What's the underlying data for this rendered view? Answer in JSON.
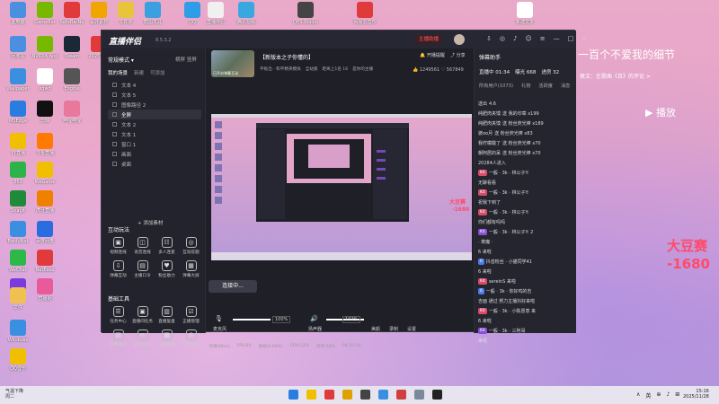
{
  "desktop": {
    "icons": [
      "此电脑",
      "GameBar",
      "ServBarNe",
      "设计素材",
      "文件夹",
      "截图工具",
      "QQ",
      "直播伴侣",
      "腾讯视频",
      "OBS Studio",
      "网易云音乐",
      "新建文本",
      "回收站",
      "NVIDIA App",
      "Steam",
      "2025文档",
      "Wallpaper",
      "xqwd",
      "Engine",
      "MSEdge",
      "剪映",
      "哔哩哔哩",
      "YY直播",
      "斗鱼直播",
      "360",
      "WeGame",
      "Snagit",
      "虎牙直播",
      "BaiduNet",
      "百度网盘",
      "WeChat",
      "NetEase",
      "RGB",
      "直播姬",
      "文件",
      "Windows",
      "QQ音乐"
    ],
    "lyric_line": "一百个不爱我的细节",
    "lyric_source": "原文：在歌曲《百》的评论 >",
    "play_label": "播放",
    "bean_score": "大豆赛",
    "bean_value": "-1680"
  },
  "app": {
    "title": "直播伴侣",
    "version": "8.5.3.2",
    "live_status": "主播助播",
    "window_icons": [
      "⇩",
      "◎",
      "♪",
      "☺",
      "≡",
      "—",
      "□",
      "✕"
    ],
    "left": {
      "mode_label": "常规模式 ▾",
      "mode_right": "横屏 竖屏",
      "scene_tabs": [
        "我的场景",
        "新建",
        "可添加"
      ],
      "sources": [
        "文本 4",
        "文本 5",
        "图像路径 2",
        "全屏",
        "文本 2",
        "文本 1",
        "窗口 1",
        "画面",
        "桌面"
      ],
      "add_source": "+ 添加素材",
      "interactive_title": "互动玩法",
      "interactive": [
        "视频连线",
        "语音连线",
        "多人连麦",
        "互动答题",
        "弹幕互动",
        "主播口令",
        "粉丝助力",
        "弹幕大屏"
      ],
      "basic_title": "基础工具",
      "basic": [
        "任务中心",
        "直播间任务",
        "直播复盘",
        "正播管理",
        "弹幕助手",
        "截帧分享",
        "直播剪辑",
        "下播保存"
      ],
      "more_label": "··· 更多功能"
    },
    "center": {
      "stream_title": "【新版本之子你懂的】",
      "cover_label": "已开启弹幕互动",
      "start_btn": "开播提醒",
      "share_btn": "分享",
      "meta": [
        "平板出 · 和平精英模拟",
        "全站版",
        "距离上1名 16",
        "是你的主播"
      ],
      "viewers": "1249561",
      "likes": "567849",
      "mic_label": "麦克风",
      "mic_pct": "100%",
      "speaker_label": "扬声器",
      "speaker_pct": "102%",
      "tools": [
        "美颜",
        "录制",
        "设置"
      ],
      "go_live": "连接中...",
      "status": [
        "码率(Kb/s)",
        "FPS:60",
        "丢帧(0.00%)",
        "CPU:12%",
        "内存:58%",
        "04:32:14"
      ]
    },
    "right": {
      "title": "弹幕助手",
      "stats": [
        "直播中 01:34",
        "曝光 668",
        "进房 32"
      ],
      "tabs": [
        "所有用户(1073)",
        "礼物",
        "活跃度",
        "消息"
      ],
      "messages": [
        {
          "u": "送出",
          "t": "4.6",
          "badge": ""
        },
        {
          "u": "纯肥肉夹馍",
          "t": "送 我的印章 x199",
          "badge": ""
        },
        {
          "u": "纯肥肉夹馍",
          "t": "送 粉丝荧光棒 x189",
          "badge": ""
        },
        {
          "u": "彼oo月",
          "t": "送 粉丝荧光棒 x83",
          "badge": ""
        },
        {
          "u": "我柠檬酸了",
          "t": "送 粉丝荧光棒 x70",
          "badge": ""
        },
        {
          "u": "朝阿居的呆",
          "t": "送 粉丝荧光棒 x70",
          "badge": ""
        },
        {
          "u": "",
          "t": "20284人进入",
          "badge": ""
        },
        {
          "u": "Kit",
          "t": "一般 · 3k · 林公子Y:",
          "badge": "red"
        },
        {
          "u": "无聊看看",
          "t": "",
          "badge": ""
        },
        {
          "u": "Kit",
          "t": "一般 · 3k · 林公子Y:",
          "badge": "red"
        },
        {
          "u": "祝我下到了",
          "t": "",
          "badge": ""
        },
        {
          "u": "Kit",
          "t": "一般 · 3k · 林公子Y:",
          "badge": "red"
        },
        {
          "u": "你们都有吗吗",
          "t": "",
          "badge": ""
        },
        {
          "u": "Kit",
          "t": "一般 · 3k · 林公子Y: 2",
          "badge": "purple"
        },
        {
          "u": "",
          "t": "· 菜魔 ·",
          "badge": ""
        },
        {
          "u": "6 来啦",
          "t": "",
          "badge": ""
        },
        {
          "u": "6",
          "t": "抖音粉丝 · 小猫同学41",
          "badge": "blue"
        },
        {
          "u": "6 来啦",
          "t": "",
          "badge": ""
        },
        {
          "u": "Kit",
          "t": "sereinS 来啦",
          "badge": "red"
        },
        {
          "u": "6",
          "t": "一般 · 3k · 你好鸡的吉",
          "badge": "blue"
        },
        {
          "u": "吉面 通过 努力主播抖好来啦",
          "t": "",
          "badge": ""
        },
        {
          "u": "Kit",
          "t": "一般 · 3k · 小陈愿意 来",
          "badge": "red"
        },
        {
          "u": "6 来啦",
          "t": "",
          "badge": ""
        },
        {
          "u": "Kit",
          "t": "一般 · 3k · 三阿哥",
          "badge": "purple"
        },
        {
          "u": "来啦",
          "t": "",
          "badge": ""
        }
      ]
    }
  },
  "taskbar": {
    "weather_temp": "气温下降",
    "weather_sub": "周二",
    "apps": 9,
    "tray": [
      "∧",
      "英",
      "⊕",
      "♪",
      "⊞"
    ],
    "time": "15:16",
    "date": "2025/11/28"
  },
  "colors": {
    "accent": "#4d7de8",
    "live_red": "#ff5c5c",
    "bean_red": "#ff4a6a"
  }
}
